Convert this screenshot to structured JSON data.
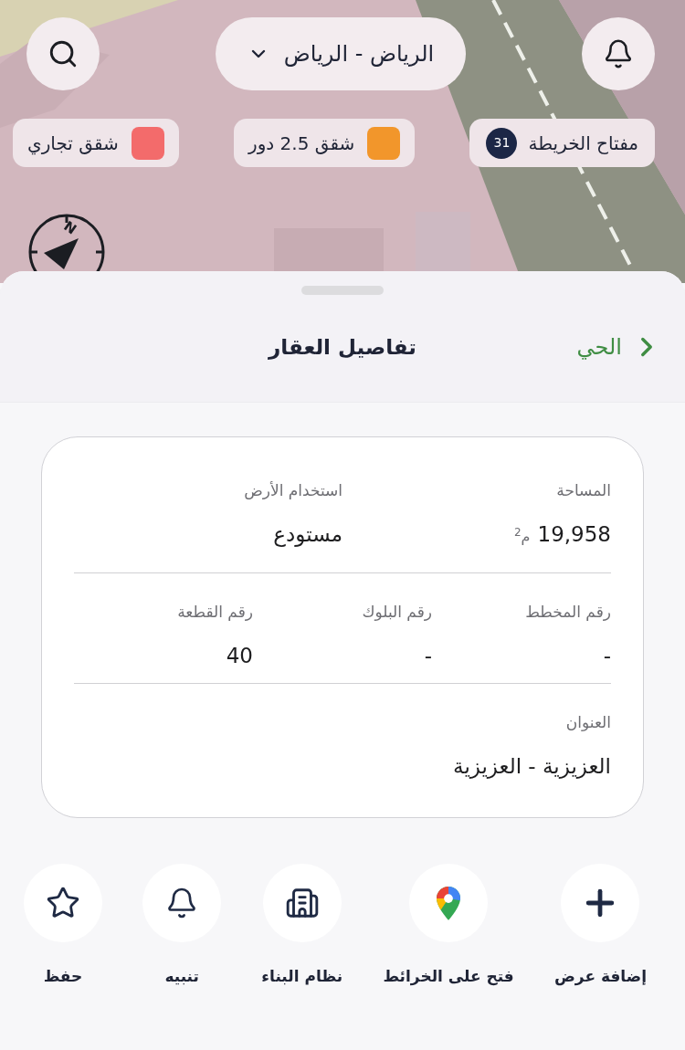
{
  "map": {
    "city_selector": {
      "label": "الرياض - الرياض"
    },
    "legend": [
      {
        "kind": "key",
        "label": "مفتاح الخريطة",
        "count": "31"
      },
      {
        "kind": "swatch",
        "label": "شقق 2.5 دور",
        "color": "#f2962b"
      },
      {
        "kind": "swatch",
        "label": "شقق تجاري",
        "color": "#f36b6b"
      }
    ],
    "compass": {
      "label": "N"
    }
  },
  "sheet": {
    "back_link": "الحي",
    "title": "تفاصيل العقار"
  },
  "details": {
    "rows": [
      {
        "fields": [
          {
            "label": "المساحة",
            "value": "19,958",
            "unit": "م$^{2}$"
          },
          {
            "label": "استخدام الأرض",
            "value": "مستودع"
          }
        ]
      },
      {
        "fields": [
          {
            "label": "رقم المخطط",
            "value": "-"
          },
          {
            "label": "رقم البلوك",
            "value": "-"
          },
          {
            "label": "رقم القطعة",
            "value": "40"
          }
        ]
      },
      {
        "fields": [
          {
            "label": "العنوان",
            "value": "العزيزية - العزيزية"
          }
        ]
      }
    ]
  },
  "actions": [
    {
      "kind": "add",
      "label": "إضافة عرض"
    },
    {
      "kind": "maps",
      "label": "فتح على الخرائط"
    },
    {
      "kind": "building",
      "label": "نظام البناء"
    },
    {
      "kind": "alert",
      "label": "تنبيه"
    },
    {
      "kind": "save",
      "label": "حفظ"
    }
  ]
}
